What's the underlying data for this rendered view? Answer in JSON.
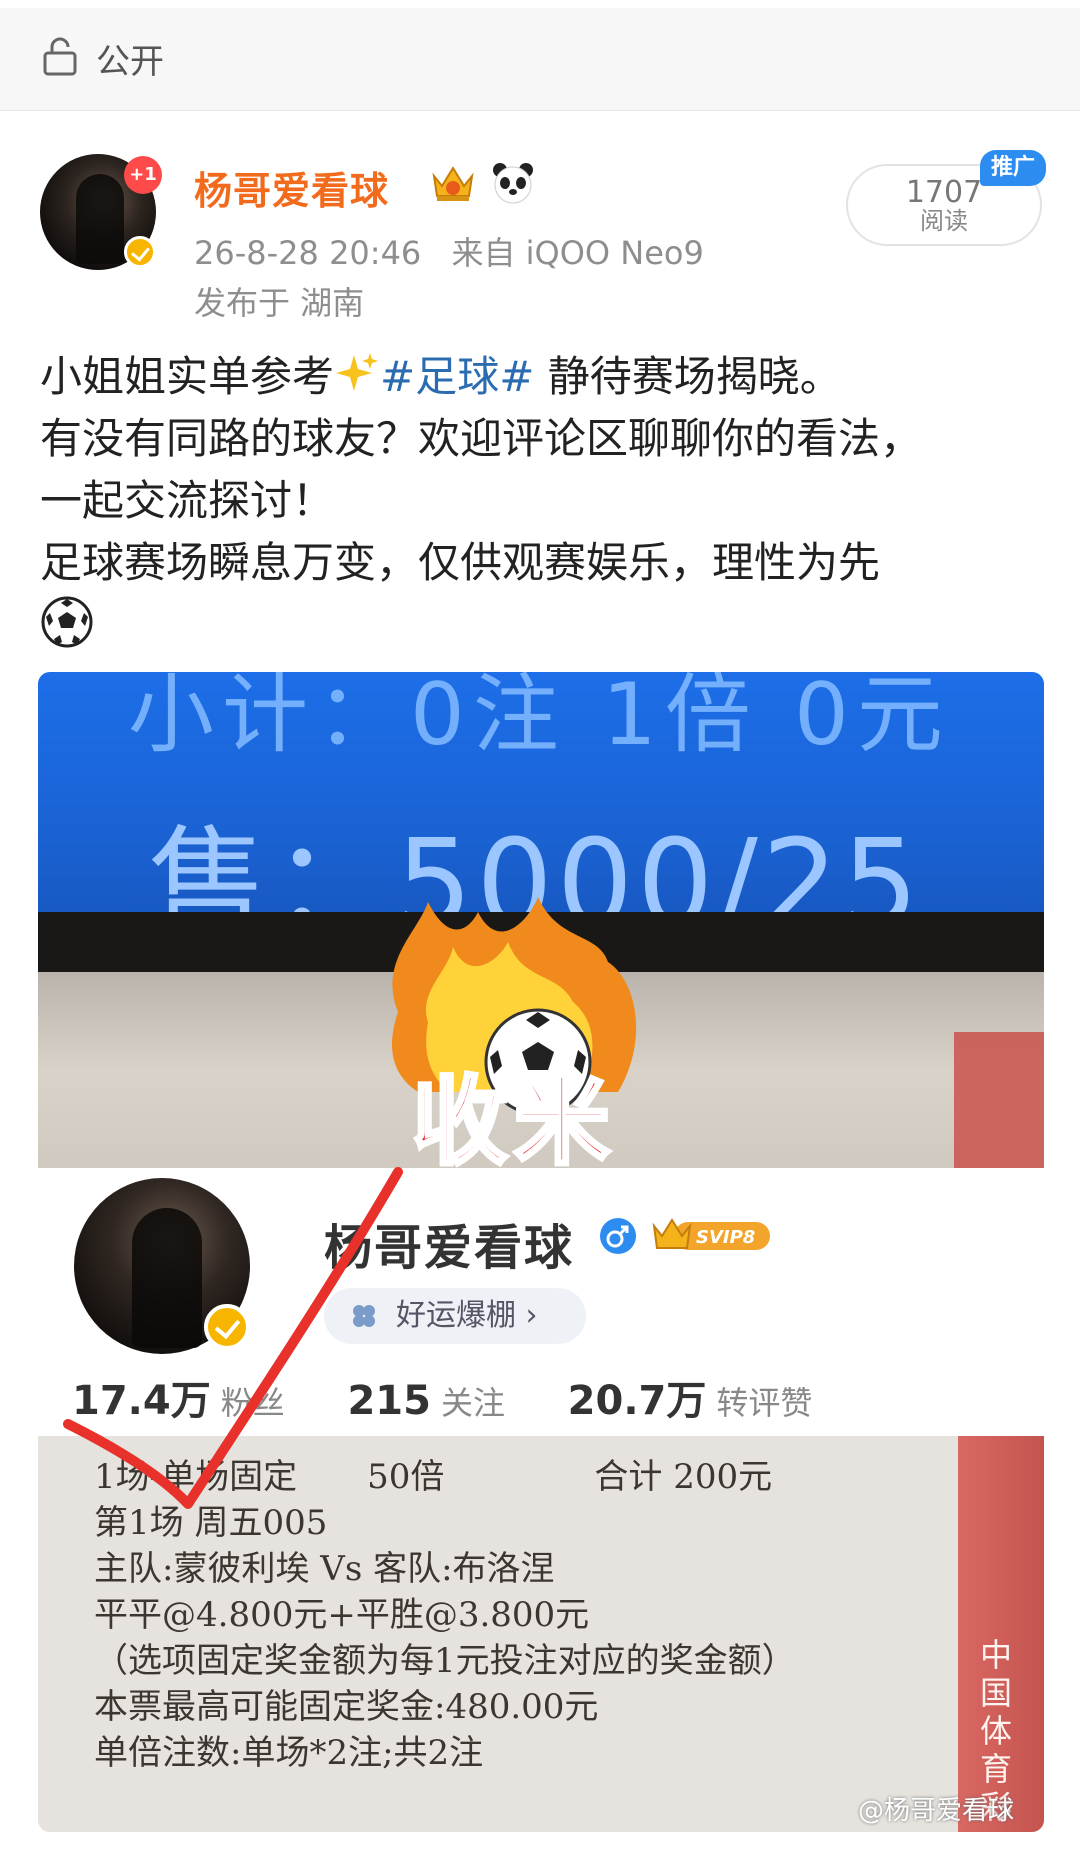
{
  "header": {
    "privacy_label": "公开"
  },
  "author": {
    "name": "杨哥爱看球",
    "notification_badge": "+1",
    "timestamp": "26-8-28 20:46",
    "source": "来自 iQOO Neo9",
    "location": "发布于 湖南"
  },
  "views": {
    "count": "1707",
    "label": "阅读",
    "promo_tag": "推广"
  },
  "post": {
    "line1_pre": "小姐姐实单参考",
    "hashtag": "#足球#",
    "line1_post": " 静待赛场揭晓。",
    "line2": "有没有同路的球友？欢迎评论区聊聊你的看法，",
    "line3": "一起交流探讨！",
    "line4": "足球赛场瞬息万变，仅供观赛娱乐，理性为先"
  },
  "image": {
    "screen_line1": "小计：0注 1倍 0元",
    "screen_line2": "售：5000/25",
    "stamp": "收米",
    "profile_name": "杨哥爱看球",
    "svip_label": "SVIP8",
    "chip_label": "好运爆棚 ›",
    "stats": [
      {
        "value": "17.4万",
        "label": "粉丝"
      },
      {
        "value": "215",
        "label": "关注"
      },
      {
        "value": "20.7万",
        "label": "转评赞"
      }
    ],
    "receipt": {
      "line1_a": "1场-单场固定",
      "line1_b": "50倍",
      "line1_c": "合计 200元",
      "line2": "第1场  周五005",
      "line3": "主队:蒙彼利埃 Vs 客队:布洛涅",
      "line4": "平平@4.800元+平胜@3.800元",
      "line5": "（选项固定奖金额为每1元投注对应的奖金额）",
      "line6": "本票最高可能固定奖金:480.00元",
      "line7": "单倍注数:单场*2注;共2注",
      "side_label": "中国体育彩"
    },
    "watermark": "@杨哥爱看球"
  },
  "colors": {
    "username": "#f26b1d",
    "hashtag": "#2b6bb0",
    "promo": "#2d8cf0",
    "stamp": "#e6191e",
    "check": "#e8312a"
  }
}
